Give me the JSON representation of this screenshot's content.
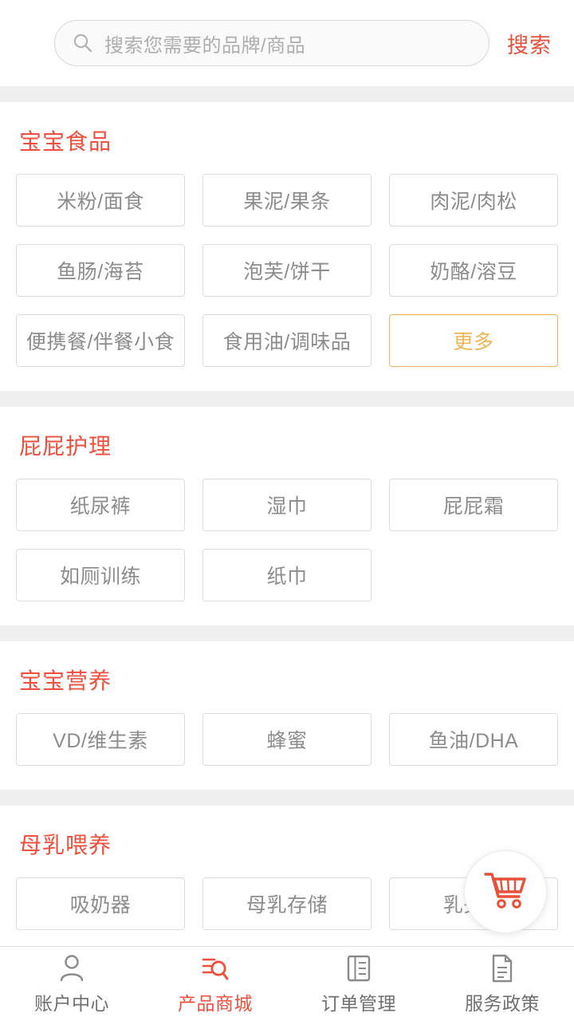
{
  "search": {
    "placeholder": "搜索您需要的品牌/商品",
    "value": "",
    "button_label": "搜索",
    "icon": "search-icon"
  },
  "sections": [
    {
      "title": "宝宝食品",
      "items": [
        {
          "label": "米粉/面食",
          "highlight": false
        },
        {
          "label": "果泥/果条",
          "highlight": false
        },
        {
          "label": "肉泥/肉松",
          "highlight": false
        },
        {
          "label": "鱼肠/海苔",
          "highlight": false
        },
        {
          "label": "泡芙/饼干",
          "highlight": false
        },
        {
          "label": "奶酪/溶豆",
          "highlight": false
        },
        {
          "label": "便携餐/伴餐小食",
          "highlight": false
        },
        {
          "label": "食用油/调味品",
          "highlight": false
        },
        {
          "label": "更多",
          "highlight": true
        }
      ]
    },
    {
      "title": "屁屁护理",
      "items": [
        {
          "label": "纸尿裤",
          "highlight": false
        },
        {
          "label": "湿巾",
          "highlight": false
        },
        {
          "label": "屁屁霜",
          "highlight": false
        },
        {
          "label": "如厕训练",
          "highlight": false
        },
        {
          "label": "纸巾",
          "highlight": false
        }
      ]
    },
    {
      "title": "宝宝营养",
      "items": [
        {
          "label": "VD/维生素",
          "highlight": false
        },
        {
          "label": "蜂蜜",
          "highlight": false
        },
        {
          "label": "鱼油/DHA",
          "highlight": false
        }
      ]
    },
    {
      "title": "母乳喂养",
      "items": [
        {
          "label": "吸奶器",
          "highlight": false
        },
        {
          "label": "母乳存储",
          "highlight": false
        },
        {
          "label": "乳头霜",
          "highlight": false
        }
      ]
    }
  ],
  "cart": {
    "icon": "shopping-cart-icon"
  },
  "tabbar": {
    "items": [
      {
        "label": "账户中心",
        "icon": "user-icon",
        "active": false
      },
      {
        "label": "产品商城",
        "icon": "store-search-icon",
        "active": true
      },
      {
        "label": "订单管理",
        "icon": "order-list-icon",
        "active": false
      },
      {
        "label": "服务政策",
        "icon": "document-icon",
        "active": false
      }
    ]
  },
  "colors": {
    "accent": "#ef4f3c",
    "chip_border": "#dcdcdc",
    "chip_text": "#8c8c8c",
    "more_border": "#f0b455",
    "divider": "#f0f0f0"
  }
}
